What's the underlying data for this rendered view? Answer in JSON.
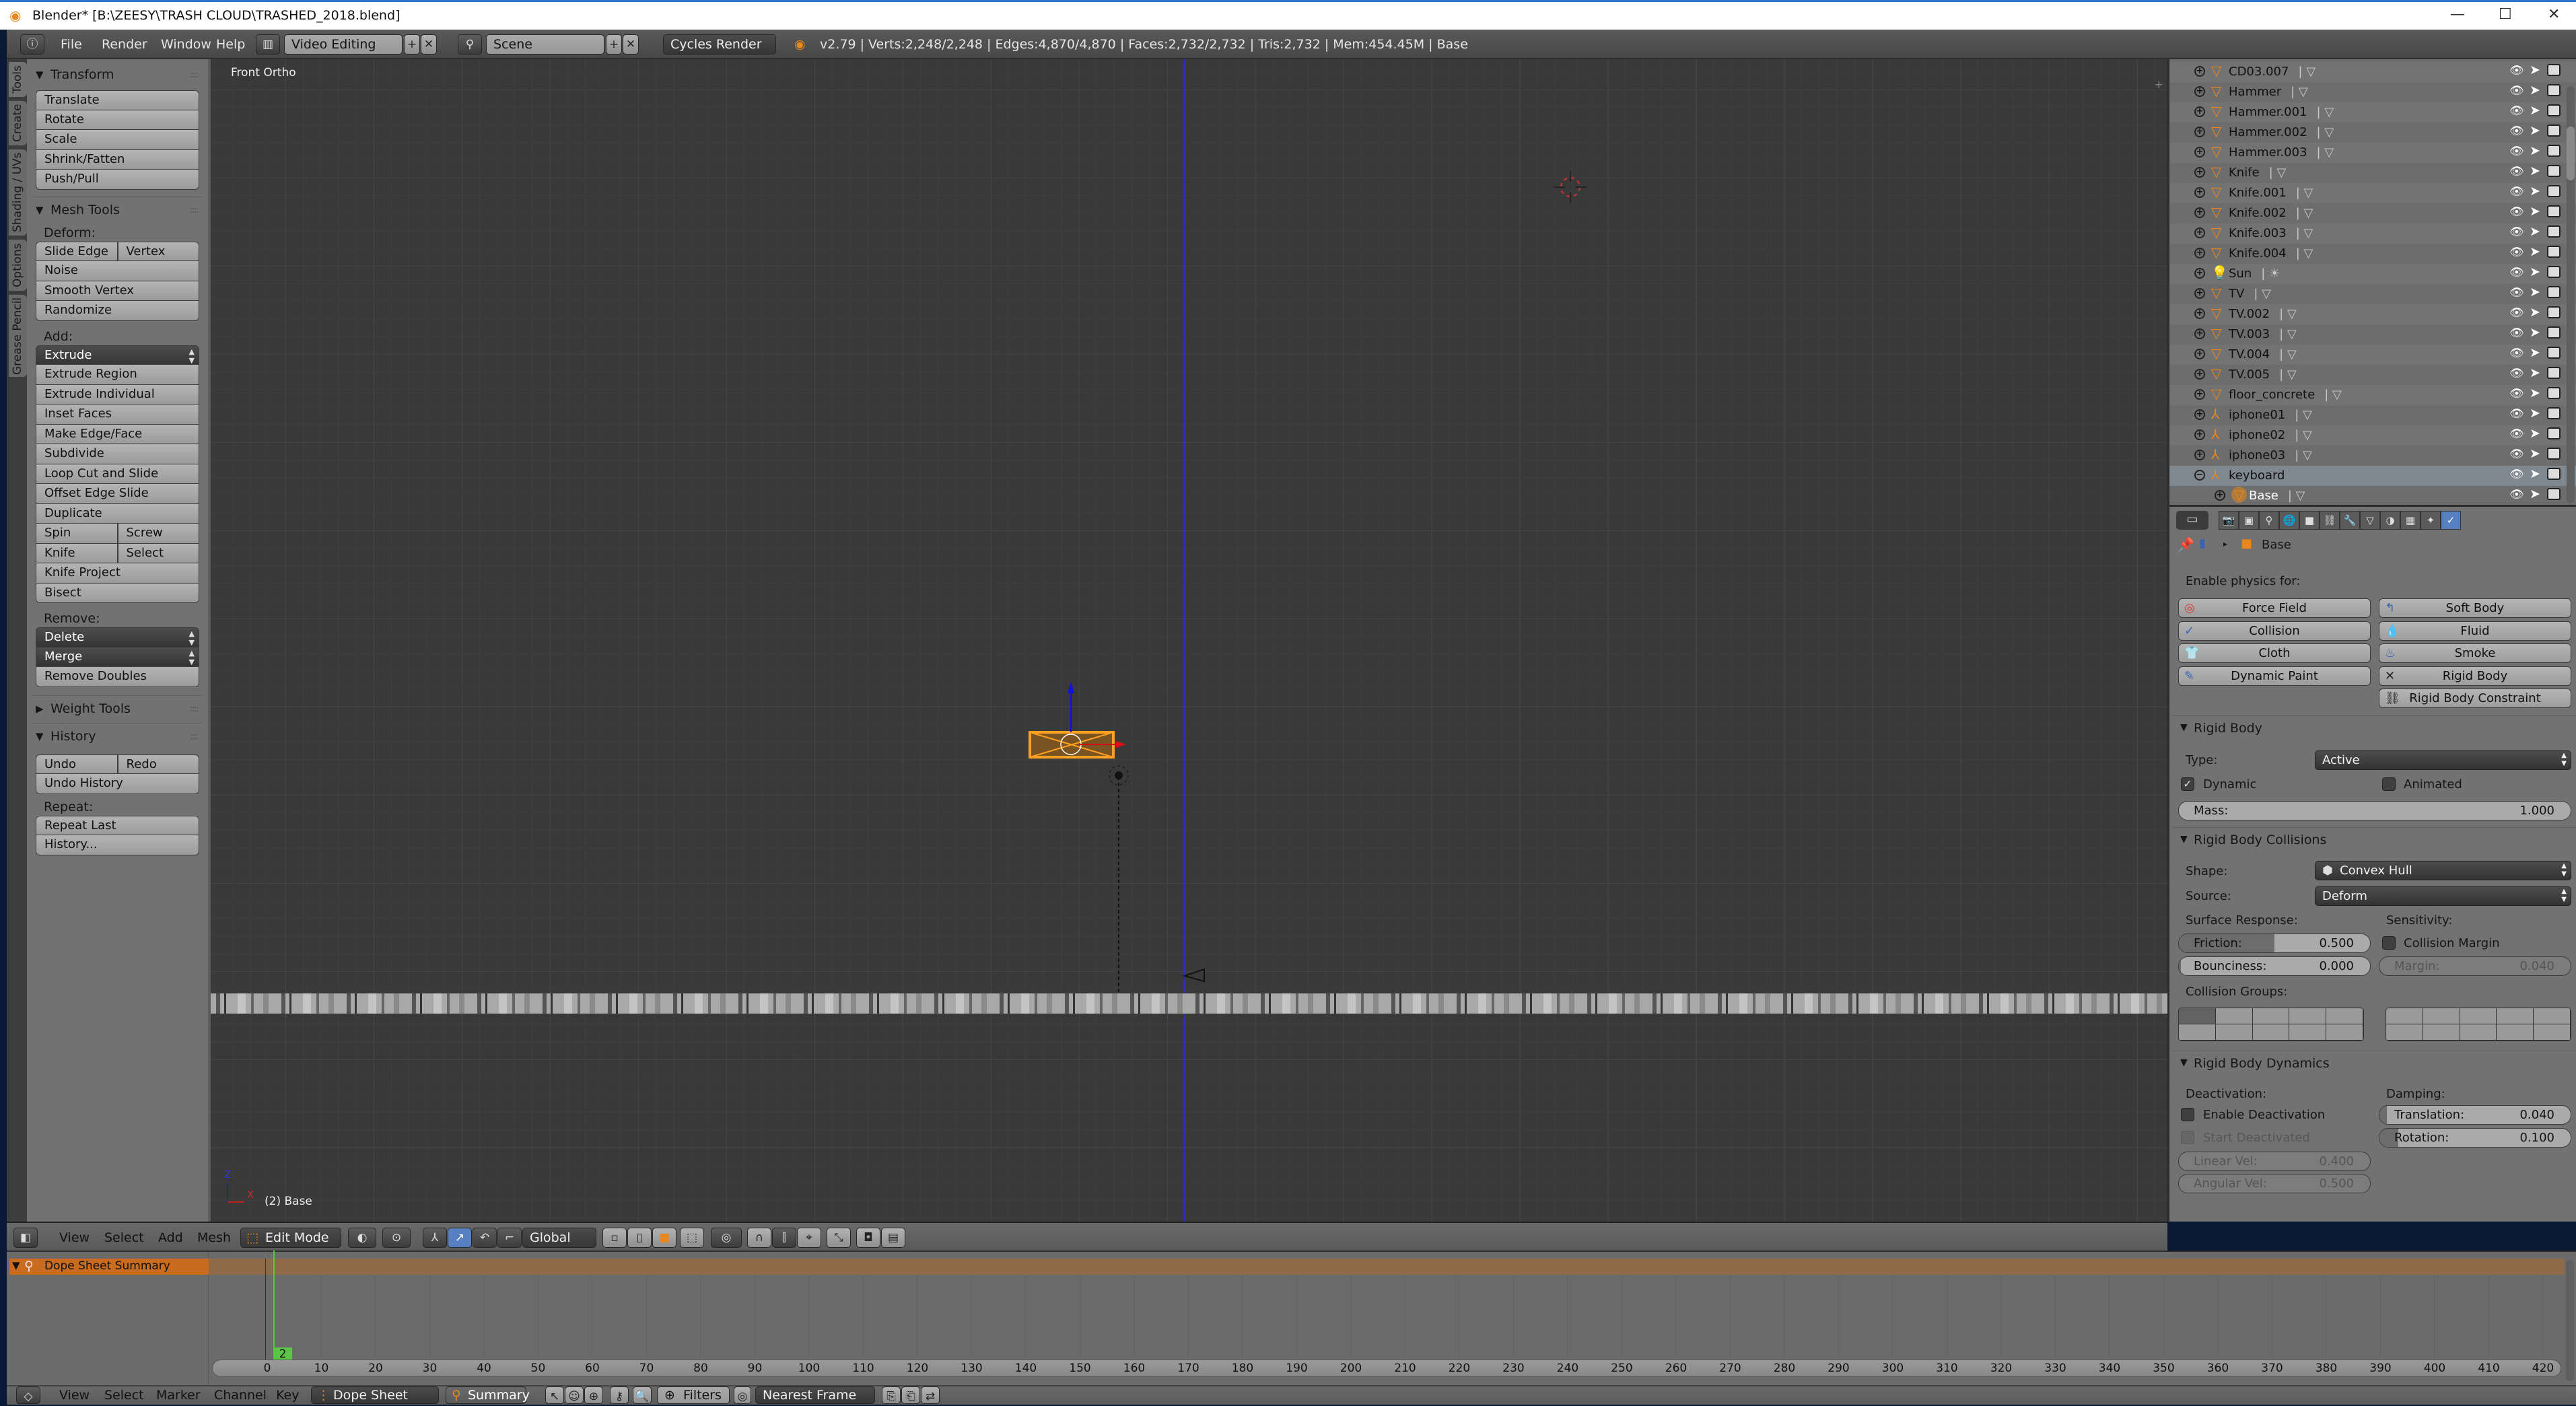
{
  "window": {
    "title": "Blender* [B:\\ZEESY\\TRASH CLOUD\\TRASHED_2018.blend]",
    "minimize": "—",
    "maximize": "☐",
    "close": "✕"
  },
  "info_header": {
    "menus": [
      "File",
      "Render",
      "Window",
      "Help"
    ],
    "screen_layout": "Video Editing",
    "scene": "Scene",
    "render_engine": "Cycles Render",
    "stats": "v2.79 | Verts:2,248/2,248 | Edges:4,870/4,870 | Faces:2,732/2,732 | Tris:2,732 | Mem:454.45M | Base"
  },
  "tool_tabs": [
    "Tools",
    "Create",
    "Shading / UVs",
    "Options",
    "Grease Pencil"
  ],
  "tool_panel": {
    "transform": {
      "title": "Transform",
      "buttons": [
        "Translate",
        "Rotate",
        "Scale",
        "Shrink/Fatten",
        "Push/Pull"
      ]
    },
    "mesh_tools": {
      "title": "Mesh Tools",
      "deform_label": "Deform:",
      "deform": {
        "slide_edge": "Slide Edge",
        "vertex": "Vertex",
        "noise": "Noise",
        "smooth_vertex": "Smooth Vertex",
        "randomize": "Randomize"
      },
      "add_label": "Add:",
      "add": {
        "extrude": "Extrude",
        "extrude_region": "Extrude Region",
        "extrude_individual": "Extrude Individual",
        "inset_faces": "Inset Faces",
        "make_edge_face": "Make Edge/Face",
        "subdivide": "Subdivide",
        "loop_cut": "Loop Cut and Slide",
        "offset_edge": "Offset Edge Slide",
        "duplicate": "Duplicate",
        "spin": "Spin",
        "screw": "Screw",
        "knife": "Knife",
        "select": "Select",
        "knife_project": "Knife Project",
        "bisect": "Bisect"
      },
      "remove_label": "Remove:",
      "remove": {
        "delete": "Delete",
        "merge": "Merge",
        "remove_doubles": "Remove Doubles"
      }
    },
    "weight_tools": {
      "title": "Weight Tools"
    },
    "history": {
      "title": "History",
      "undo": "Undo",
      "redo": "Redo",
      "undo_history": "Undo History",
      "repeat_label": "Repeat:",
      "repeat_last": "Repeat Last",
      "history_menu": "History..."
    }
  },
  "viewport": {
    "view_name": "Front Ortho",
    "object_info": "(2) Base",
    "axis_z": "Z",
    "axis_x": "X",
    "header": {
      "menus": [
        "View",
        "Select",
        "Add",
        "Mesh"
      ],
      "mode": "Edit Mode",
      "orientation": "Global"
    }
  },
  "outliner": {
    "rows": [
      {
        "name": "CD03.007",
        "type": "mesh"
      },
      {
        "name": "Hammer",
        "type": "mesh"
      },
      {
        "name": "Hammer.001",
        "type": "mesh"
      },
      {
        "name": "Hammer.002",
        "type": "mesh"
      },
      {
        "name": "Hammer.003",
        "type": "mesh"
      },
      {
        "name": "Knife",
        "type": "mesh"
      },
      {
        "name": "Knife.001",
        "type": "mesh"
      },
      {
        "name": "Knife.002",
        "type": "mesh"
      },
      {
        "name": "Knife.003",
        "type": "mesh"
      },
      {
        "name": "Knife.004",
        "type": "mesh"
      },
      {
        "name": "Sun",
        "type": "lamp"
      },
      {
        "name": "TV",
        "type": "mesh"
      },
      {
        "name": "TV.002",
        "type": "mesh"
      },
      {
        "name": "TV.003",
        "type": "mesh"
      },
      {
        "name": "TV.004",
        "type": "mesh"
      },
      {
        "name": "TV.005",
        "type": "mesh"
      },
      {
        "name": "floor_concrete",
        "type": "mesh"
      },
      {
        "name": "iphone01",
        "type": "empty"
      },
      {
        "name": "iphone02",
        "type": "empty"
      },
      {
        "name": "iphone03",
        "type": "empty"
      },
      {
        "name": "keyboard",
        "type": "empty",
        "expanded": true
      },
      {
        "name": "Base",
        "type": "mesh",
        "child": true,
        "active": true
      }
    ]
  },
  "properties": {
    "context_tabs": [
      "render",
      "render-layers",
      "scene",
      "world",
      "object",
      "constraints",
      "modifiers",
      "data",
      "material",
      "texture",
      "particles",
      "physics"
    ],
    "active_tab": "physics",
    "breadcrumb": "Base",
    "enable_label": "Enable physics for:",
    "physics_buttons": {
      "force_field": "Force Field",
      "soft_body": "Soft Body",
      "collision": "Collision",
      "fluid": "Fluid",
      "cloth": "Cloth",
      "smoke": "Smoke",
      "dynamic_paint": "Dynamic Paint",
      "rigid_body": "Rigid Body",
      "rigid_body_constraint": "Rigid Body Constraint"
    },
    "rigid_body": {
      "title": "Rigid Body",
      "type_label": "Type:",
      "type": "Active",
      "dynamic": "Dynamic",
      "dynamic_checked": true,
      "animated": "Animated",
      "animated_checked": false,
      "mass_label": "Mass:",
      "mass": "1.000"
    },
    "collisions": {
      "title": "Rigid Body Collisions",
      "shape_label": "Shape:",
      "shape": "Convex Hull",
      "source_label": "Source:",
      "source": "Deform",
      "surface_label": "Surface Response:",
      "friction_label": "Friction:",
      "friction": "0.500",
      "friction_fill": 0.5,
      "bounciness_label": "Bounciness:",
      "bounciness": "0.000",
      "bounciness_fill": 0.0,
      "sensitivity_label": "Sensitivity:",
      "collision_margin": "Collision Margin",
      "collision_margin_checked": false,
      "margin_label": "Margin:",
      "margin": "0.040",
      "groups_label": "Collision Groups:",
      "active_group": 1
    },
    "dynamics": {
      "title": "Rigid Body Dynamics",
      "deactivation_label": "Deactivation:",
      "enable_deactivation": "Enable Deactivation",
      "start_deactivated": "Start Deactivated",
      "linear_label": "Linear Vel:",
      "linear": "0.400",
      "angular_label": "Angular Vel:",
      "angular": "0.500",
      "damping_label": "Damping:",
      "translation_label": "Translation:",
      "translation": "0.040",
      "translation_fill": 0.04,
      "rotation_label": "Rotation:",
      "rotation": "0.100",
      "rotation_fill": 0.1
    }
  },
  "dope_sheet": {
    "summary": "Dope Sheet Summary",
    "current_frame": "2",
    "ruler_ticks": [
      "0",
      "10",
      "20",
      "30",
      "40",
      "50",
      "60",
      "70",
      "80",
      "90",
      "100",
      "110",
      "120",
      "130",
      "140",
      "150",
      "160",
      "170",
      "180",
      "190",
      "200",
      "210",
      "220",
      "230",
      "240",
      "250",
      "260",
      "270",
      "280",
      "290",
      "300",
      "310",
      "320",
      "330",
      "340",
      "350",
      "360",
      "370",
      "380",
      "390",
      "400",
      "410",
      "420"
    ],
    "header": {
      "menus": [
        "View",
        "Select",
        "Marker",
        "Channel",
        "Key"
      ],
      "mode": "Dope Sheet",
      "summary_btn": "Summary",
      "filters": "Filters",
      "snap": "Nearest Frame"
    }
  },
  "colors": {
    "accent_orange": "#e8881c",
    "selected_blue": "#5680c2",
    "summary_orange": "#c96c1e",
    "frame_green": "#5cc545"
  }
}
